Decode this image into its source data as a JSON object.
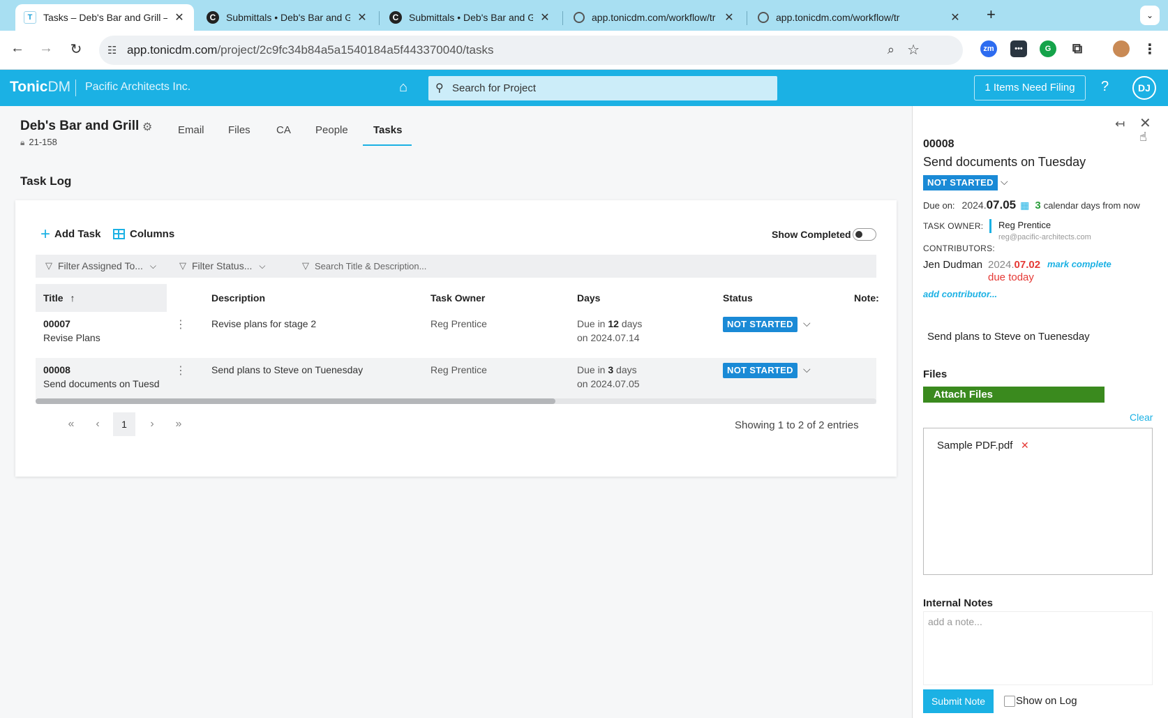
{
  "browser": {
    "tabs": [
      {
        "label": "Tasks – Deb's Bar and Grill –",
        "favicon": "T",
        "active": true
      },
      {
        "label": "Submittals • Deb's Bar and Gr",
        "favicon": "C",
        "active": false
      },
      {
        "label": "Submittals • Deb's Bar and Gr",
        "favicon": "C",
        "active": false
      },
      {
        "label": "app.tonicdm.com/workflow/tr",
        "favicon": "globe-icon",
        "active": false
      },
      {
        "label": "app.tonicdm.com/workflow/tr",
        "favicon": "globe-icon",
        "active": false
      }
    ],
    "url_host": "app.tonicdm.com",
    "url_path": "/project/2c9fc34b84a5a1540184a5f443370040/tasks",
    "extensions": [
      "zm",
      "bitwarden",
      "grammarly",
      "puzzle",
      "profile"
    ]
  },
  "app": {
    "logo": "Tonic",
    "logo_suffix": "DM",
    "company": "Pacific Architects Inc.",
    "search_placeholder": "Search for Project",
    "filing_button": "1 Items Need Filing",
    "help": "?",
    "user_initials": "DJ",
    "brand_color": "#1bb1e4"
  },
  "project": {
    "name": "Deb's Bar and Grill",
    "number": "21-158",
    "tabs": [
      "Email",
      "Files",
      "CA",
      "People",
      "Tasks"
    ],
    "active_tab": "Tasks"
  },
  "tasklog": {
    "heading": "Task Log",
    "add_task": "Add Task",
    "columns": "Columns",
    "show_completed": "Show Completed",
    "show_completed_on": false,
    "filters": {
      "assigned": "Filter Assigned To...",
      "status": "Filter Status...",
      "search": "Search Title & Description..."
    },
    "headers": [
      "Title",
      "Description",
      "Task Owner",
      "Days",
      "Status",
      "Note:"
    ],
    "rows": [
      {
        "id": "00007",
        "title": "Revise Plans",
        "description": "Revise plans for stage 2",
        "owner": "Reg Prentice",
        "days_prefix": "Due in",
        "days_num": "12",
        "days_suffix": "days",
        "due_date": "on 2024.07.14",
        "status": "NOT STARTED"
      },
      {
        "id": "00008",
        "title": "Send documents on Tuesd",
        "description": "Send plans to Steve on Tuenesday",
        "owner": "Reg Prentice",
        "days_prefix": "Due in",
        "days_num": "3",
        "days_suffix": "days",
        "due_date": "on 2024.07.05",
        "status": "NOT STARTED"
      }
    ],
    "pagination": {
      "current_page": "1",
      "showing": "Showing 1 to 2 of 2 entries"
    }
  },
  "panel": {
    "id": "00008",
    "title": "Send documents on Tuesday",
    "status": "NOT STARTED",
    "due_label": "Due on:",
    "due_year": "2024.",
    "due_md": "07.05",
    "due_count": "3",
    "due_suffix": "calendar days from now",
    "owner_label": "TASK OWNER:",
    "owner_name": "Reg Prentice",
    "owner_email": "reg@pacific-architects.com",
    "contributors_label": "CONTRIBUTORS:",
    "contributor_name": "Jen Dudman",
    "contributor_year": "2024.",
    "contributor_md": "07.02",
    "mark_complete": "mark complete",
    "contributor_due": "due today",
    "add_contributor": "add contributor...",
    "description": "Send plans to Steve on Tuenesday",
    "files_heading": "Files",
    "attach_files": "Attach Files",
    "clear": "Clear",
    "file_name": "Sample PDF.pdf",
    "notes_heading": "Internal Notes",
    "notes_placeholder": "add a note...",
    "submit_note": "Submit Note",
    "show_on_log": "Show on Log",
    "status_color": "#1a8ad6",
    "attach_color": "#3a8a1e",
    "overdue_color": "#e53935"
  }
}
